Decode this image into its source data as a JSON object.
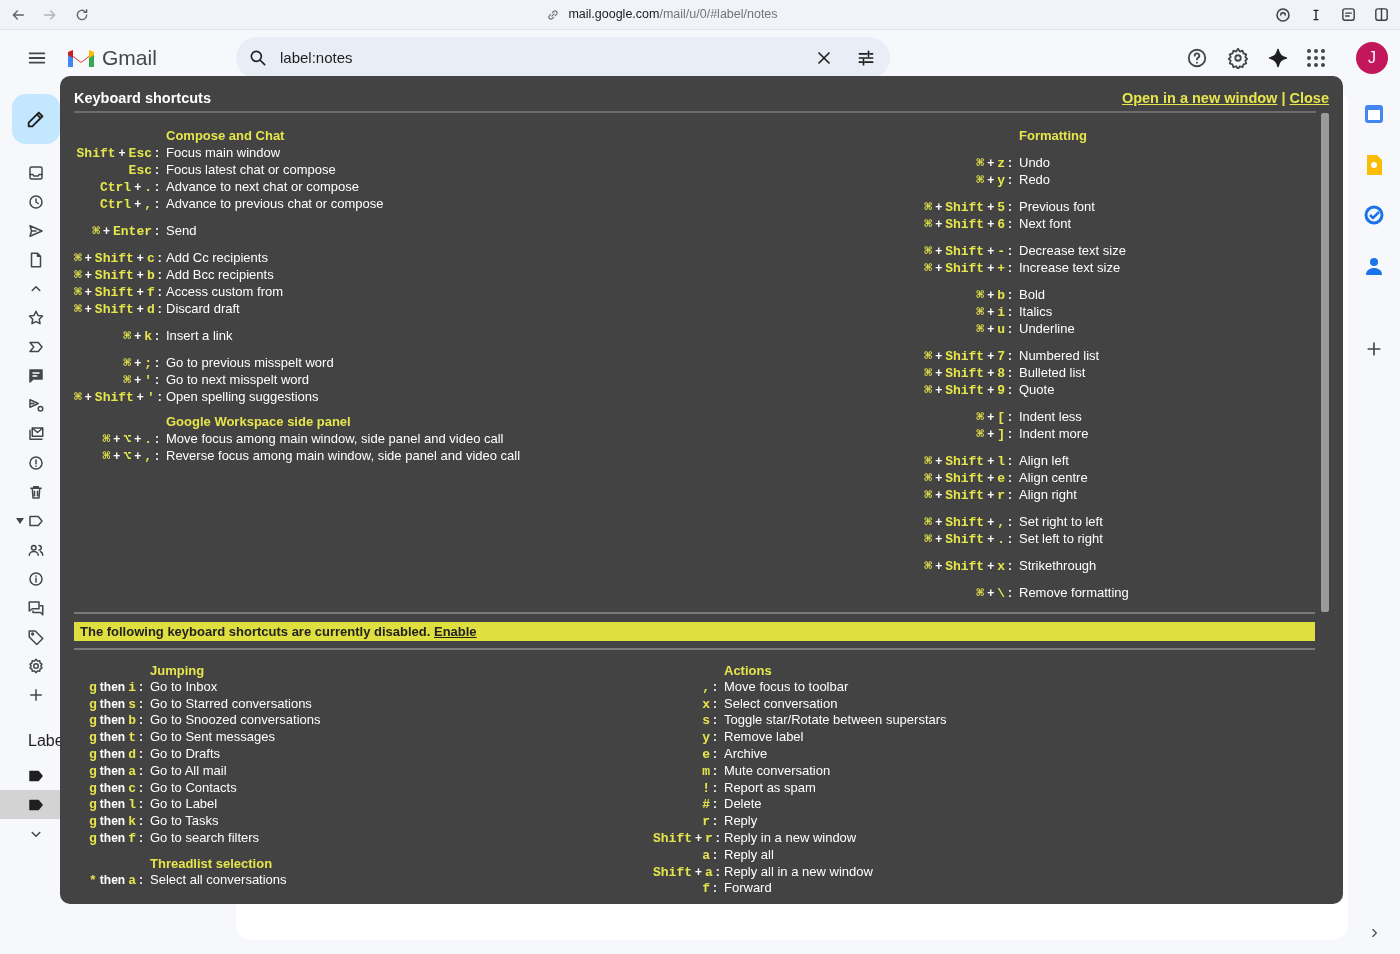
{
  "browser": {
    "url_domain": "mail.google.com",
    "url_path": "/mail/u/0/#label/notes"
  },
  "header": {
    "app_name": "Gmail",
    "search": {
      "value": "label:notes"
    },
    "avatar": "J"
  },
  "labels": {
    "heading": "Labe",
    "items": [
      {
        "selected": false
      },
      {
        "selected": true
      }
    ]
  },
  "shortcuts_dialog": {
    "title": "Keyboard shortcuts",
    "links": [
      "Open in a new window",
      "Close"
    ],
    "separator": "|",
    "top_columns": [
      {
        "sections": [
          {
            "title": "Compose and Chat",
            "groups": [
              [
                {
                  "keys": [
                    "Shift",
                    "+",
                    "Esc",
                    ":"
                  ],
                  "action": "Focus main window"
                },
                {
                  "keys": [
                    "Esc",
                    ":"
                  ],
                  "action": "Focus latest chat or compose"
                },
                {
                  "keys": [
                    "Ctrl",
                    "+",
                    ".",
                    ":"
                  ],
                  "action": "Advance to next chat or compose"
                },
                {
                  "keys": [
                    "Ctrl",
                    "+",
                    ",",
                    ":"
                  ],
                  "action": "Advance to previous chat or compose"
                }
              ],
              [
                {
                  "keys": [
                    "⌘",
                    "+",
                    "Enter",
                    ":"
                  ],
                  "action": "Send"
                }
              ],
              [
                {
                  "keys": [
                    "⌘",
                    "+",
                    "Shift",
                    "+",
                    "c",
                    ":"
                  ],
                  "action": "Add Cc recipients"
                },
                {
                  "keys": [
                    "⌘",
                    "+",
                    "Shift",
                    "+",
                    "b",
                    ":"
                  ],
                  "action": "Add Bcc recipients"
                },
                {
                  "keys": [
                    "⌘",
                    "+",
                    "Shift",
                    "+",
                    "f",
                    ":"
                  ],
                  "action": "Access custom from"
                },
                {
                  "keys": [
                    "⌘",
                    "+",
                    "Shift",
                    "+",
                    "d",
                    ":"
                  ],
                  "action": "Discard draft"
                }
              ],
              [
                {
                  "keys": [
                    "⌘",
                    "+",
                    "k",
                    ":"
                  ],
                  "action": "Insert a link"
                }
              ],
              [
                {
                  "keys": [
                    "⌘",
                    "+",
                    ";",
                    ":"
                  ],
                  "action": "Go to previous misspelt word"
                },
                {
                  "keys": [
                    "⌘",
                    "+",
                    "'",
                    ":"
                  ],
                  "action": "Go to next misspelt word"
                },
                {
                  "keys": [
                    "⌘",
                    "+",
                    "Shift",
                    "+",
                    "'",
                    ":"
                  ],
                  "action": "Open spelling suggestions"
                }
              ]
            ]
          },
          {
            "title": "Google Workspace side panel",
            "groups": [
              [
                {
                  "keys": [
                    "⌘",
                    "+",
                    "⌥",
                    "+",
                    ".",
                    ":"
                  ],
                  "action": "Move focus among main window, side panel and video call"
                },
                {
                  "keys": [
                    "⌘",
                    "+",
                    "⌥",
                    "+",
                    ",",
                    ":"
                  ],
                  "action": "Reverse focus among main window, side panel and video call"
                }
              ]
            ]
          }
        ]
      },
      {
        "sections": [
          {
            "title": "Formatting",
            "groups": [
              [
                {
                  "keys": [
                    "⌘",
                    "+",
                    "z",
                    ":"
                  ],
                  "action": "Undo"
                },
                {
                  "keys": [
                    "⌘",
                    "+",
                    "y",
                    ":"
                  ],
                  "action": "Redo"
                }
              ],
              [
                {
                  "keys": [
                    "⌘",
                    "+",
                    "Shift",
                    "+",
                    "5",
                    ":"
                  ],
                  "action": "Previous font"
                },
                {
                  "keys": [
                    "⌘",
                    "+",
                    "Shift",
                    "+",
                    "6",
                    ":"
                  ],
                  "action": "Next font"
                }
              ],
              [
                {
                  "keys": [
                    "⌘",
                    "+",
                    "Shift",
                    "+",
                    "-",
                    ":"
                  ],
                  "action": "Decrease text size"
                },
                {
                  "keys": [
                    "⌘",
                    "+",
                    "Shift",
                    "+",
                    "+",
                    ":"
                  ],
                  "action": "Increase text size"
                }
              ],
              [
                {
                  "keys": [
                    "⌘",
                    "+",
                    "b",
                    ":"
                  ],
                  "action": "Bold"
                },
                {
                  "keys": [
                    "⌘",
                    "+",
                    "i",
                    ":"
                  ],
                  "action": "Italics"
                },
                {
                  "keys": [
                    "⌘",
                    "+",
                    "u",
                    ":"
                  ],
                  "action": "Underline"
                }
              ],
              [
                {
                  "keys": [
                    "⌘",
                    "+",
                    "Shift",
                    "+",
                    "7",
                    ":"
                  ],
                  "action": "Numbered list"
                },
                {
                  "keys": [
                    "⌘",
                    "+",
                    "Shift",
                    "+",
                    "8",
                    ":"
                  ],
                  "action": "Bulleted list"
                },
                {
                  "keys": [
                    "⌘",
                    "+",
                    "Shift",
                    "+",
                    "9",
                    ":"
                  ],
                  "action": "Quote"
                }
              ],
              [
                {
                  "keys": [
                    "⌘",
                    "+",
                    "[",
                    ":"
                  ],
                  "action": "Indent less"
                },
                {
                  "keys": [
                    "⌘",
                    "+",
                    "]",
                    ":"
                  ],
                  "action": "Indent more"
                }
              ],
              [
                {
                  "keys": [
                    "⌘",
                    "+",
                    "Shift",
                    "+",
                    "l",
                    ":"
                  ],
                  "action": "Align left"
                },
                {
                  "keys": [
                    "⌘",
                    "+",
                    "Shift",
                    "+",
                    "e",
                    ":"
                  ],
                  "action": "Align centre"
                },
                {
                  "keys": [
                    "⌘",
                    "+",
                    "Shift",
                    "+",
                    "r",
                    ":"
                  ],
                  "action": "Align right"
                }
              ],
              [
                {
                  "keys": [
                    "⌘",
                    "+",
                    "Shift",
                    "+",
                    ",",
                    ":"
                  ],
                  "action": "Set right to left"
                },
                {
                  "keys": [
                    "⌘",
                    "+",
                    "Shift",
                    "+",
                    ".",
                    ":"
                  ],
                  "action": "Set left to right"
                }
              ],
              [
                {
                  "keys": [
                    "⌘",
                    "+",
                    "Shift",
                    "+",
                    "x",
                    ":"
                  ],
                  "action": "Strikethrough"
                }
              ],
              [
                {
                  "keys": [
                    "⌘",
                    "+",
                    "\\",
                    ":"
                  ],
                  "action": "Remove formatting"
                }
              ]
            ]
          }
        ]
      }
    ],
    "banner": {
      "text": "The following keyboard shortcuts are currently disabled.",
      "link": "Enable"
    },
    "bottom_columns": [
      {
        "sections": [
          {
            "title": "Jumping",
            "groups": [
              [
                {
                  "keys": [
                    "g",
                    "then",
                    "i",
                    ":"
                  ],
                  "action": "Go to Inbox"
                },
                {
                  "keys": [
                    "g",
                    "then",
                    "s",
                    ":"
                  ],
                  "action": "Go to Starred conversations"
                },
                {
                  "keys": [
                    "g",
                    "then",
                    "b",
                    ":"
                  ],
                  "action": "Go to Snoozed conversations"
                },
                {
                  "keys": [
                    "g",
                    "then",
                    "t",
                    ":"
                  ],
                  "action": "Go to Sent messages"
                },
                {
                  "keys": [
                    "g",
                    "then",
                    "d",
                    ":"
                  ],
                  "action": "Go to Drafts"
                },
                {
                  "keys": [
                    "g",
                    "then",
                    "a",
                    ":"
                  ],
                  "action": "Go to All mail"
                },
                {
                  "keys": [
                    "g",
                    "then",
                    "c",
                    ":"
                  ],
                  "action": "Go to Contacts"
                },
                {
                  "keys": [
                    "g",
                    "then",
                    "l",
                    ":"
                  ],
                  "action": "Go to Label"
                },
                {
                  "keys": [
                    "g",
                    "then",
                    "k",
                    ":"
                  ],
                  "action": "Go to Tasks"
                },
                {
                  "keys": [
                    "g",
                    "then",
                    "f",
                    ":"
                  ],
                  "action": "Go to search filters"
                }
              ]
            ]
          },
          {
            "title": "Threadlist selection",
            "groups": [
              [
                {
                  "keys": [
                    "*",
                    "then",
                    "a",
                    ":"
                  ],
                  "action": "Select all conversations"
                }
              ]
            ]
          }
        ]
      },
      {
        "sections": [
          {
            "title": "Actions",
            "groups": [
              [
                {
                  "keys": [
                    ",",
                    ":"
                  ],
                  "action": "Move focus to toolbar"
                },
                {
                  "keys": [
                    "x",
                    ":"
                  ],
                  "action": "Select conversation"
                },
                {
                  "keys": [
                    "s",
                    ":"
                  ],
                  "action": "Toggle star/Rotate between superstars"
                },
                {
                  "keys": [
                    "y",
                    ":"
                  ],
                  "action": "Remove label"
                },
                {
                  "keys": [
                    "e",
                    ":"
                  ],
                  "action": "Archive"
                },
                {
                  "keys": [
                    "m",
                    ":"
                  ],
                  "action": "Mute conversation"
                },
                {
                  "keys": [
                    "!",
                    ":"
                  ],
                  "action": "Report as spam"
                },
                {
                  "keys": [
                    "#",
                    ":"
                  ],
                  "action": "Delete"
                },
                {
                  "keys": [
                    "r",
                    ":"
                  ],
                  "action": "Reply"
                },
                {
                  "keys": [
                    "Shift",
                    "+",
                    "r",
                    ":"
                  ],
                  "action": "Reply in a new window"
                },
                {
                  "keys": [
                    "a",
                    ":"
                  ],
                  "action": "Reply all"
                },
                {
                  "keys": [
                    "Shift",
                    "+",
                    "a",
                    ":"
                  ],
                  "action": "Reply all in a new window"
                },
                {
                  "keys": [
                    "f",
                    ":"
                  ],
                  "action": "Forward"
                }
              ]
            ]
          }
        ]
      }
    ]
  }
}
